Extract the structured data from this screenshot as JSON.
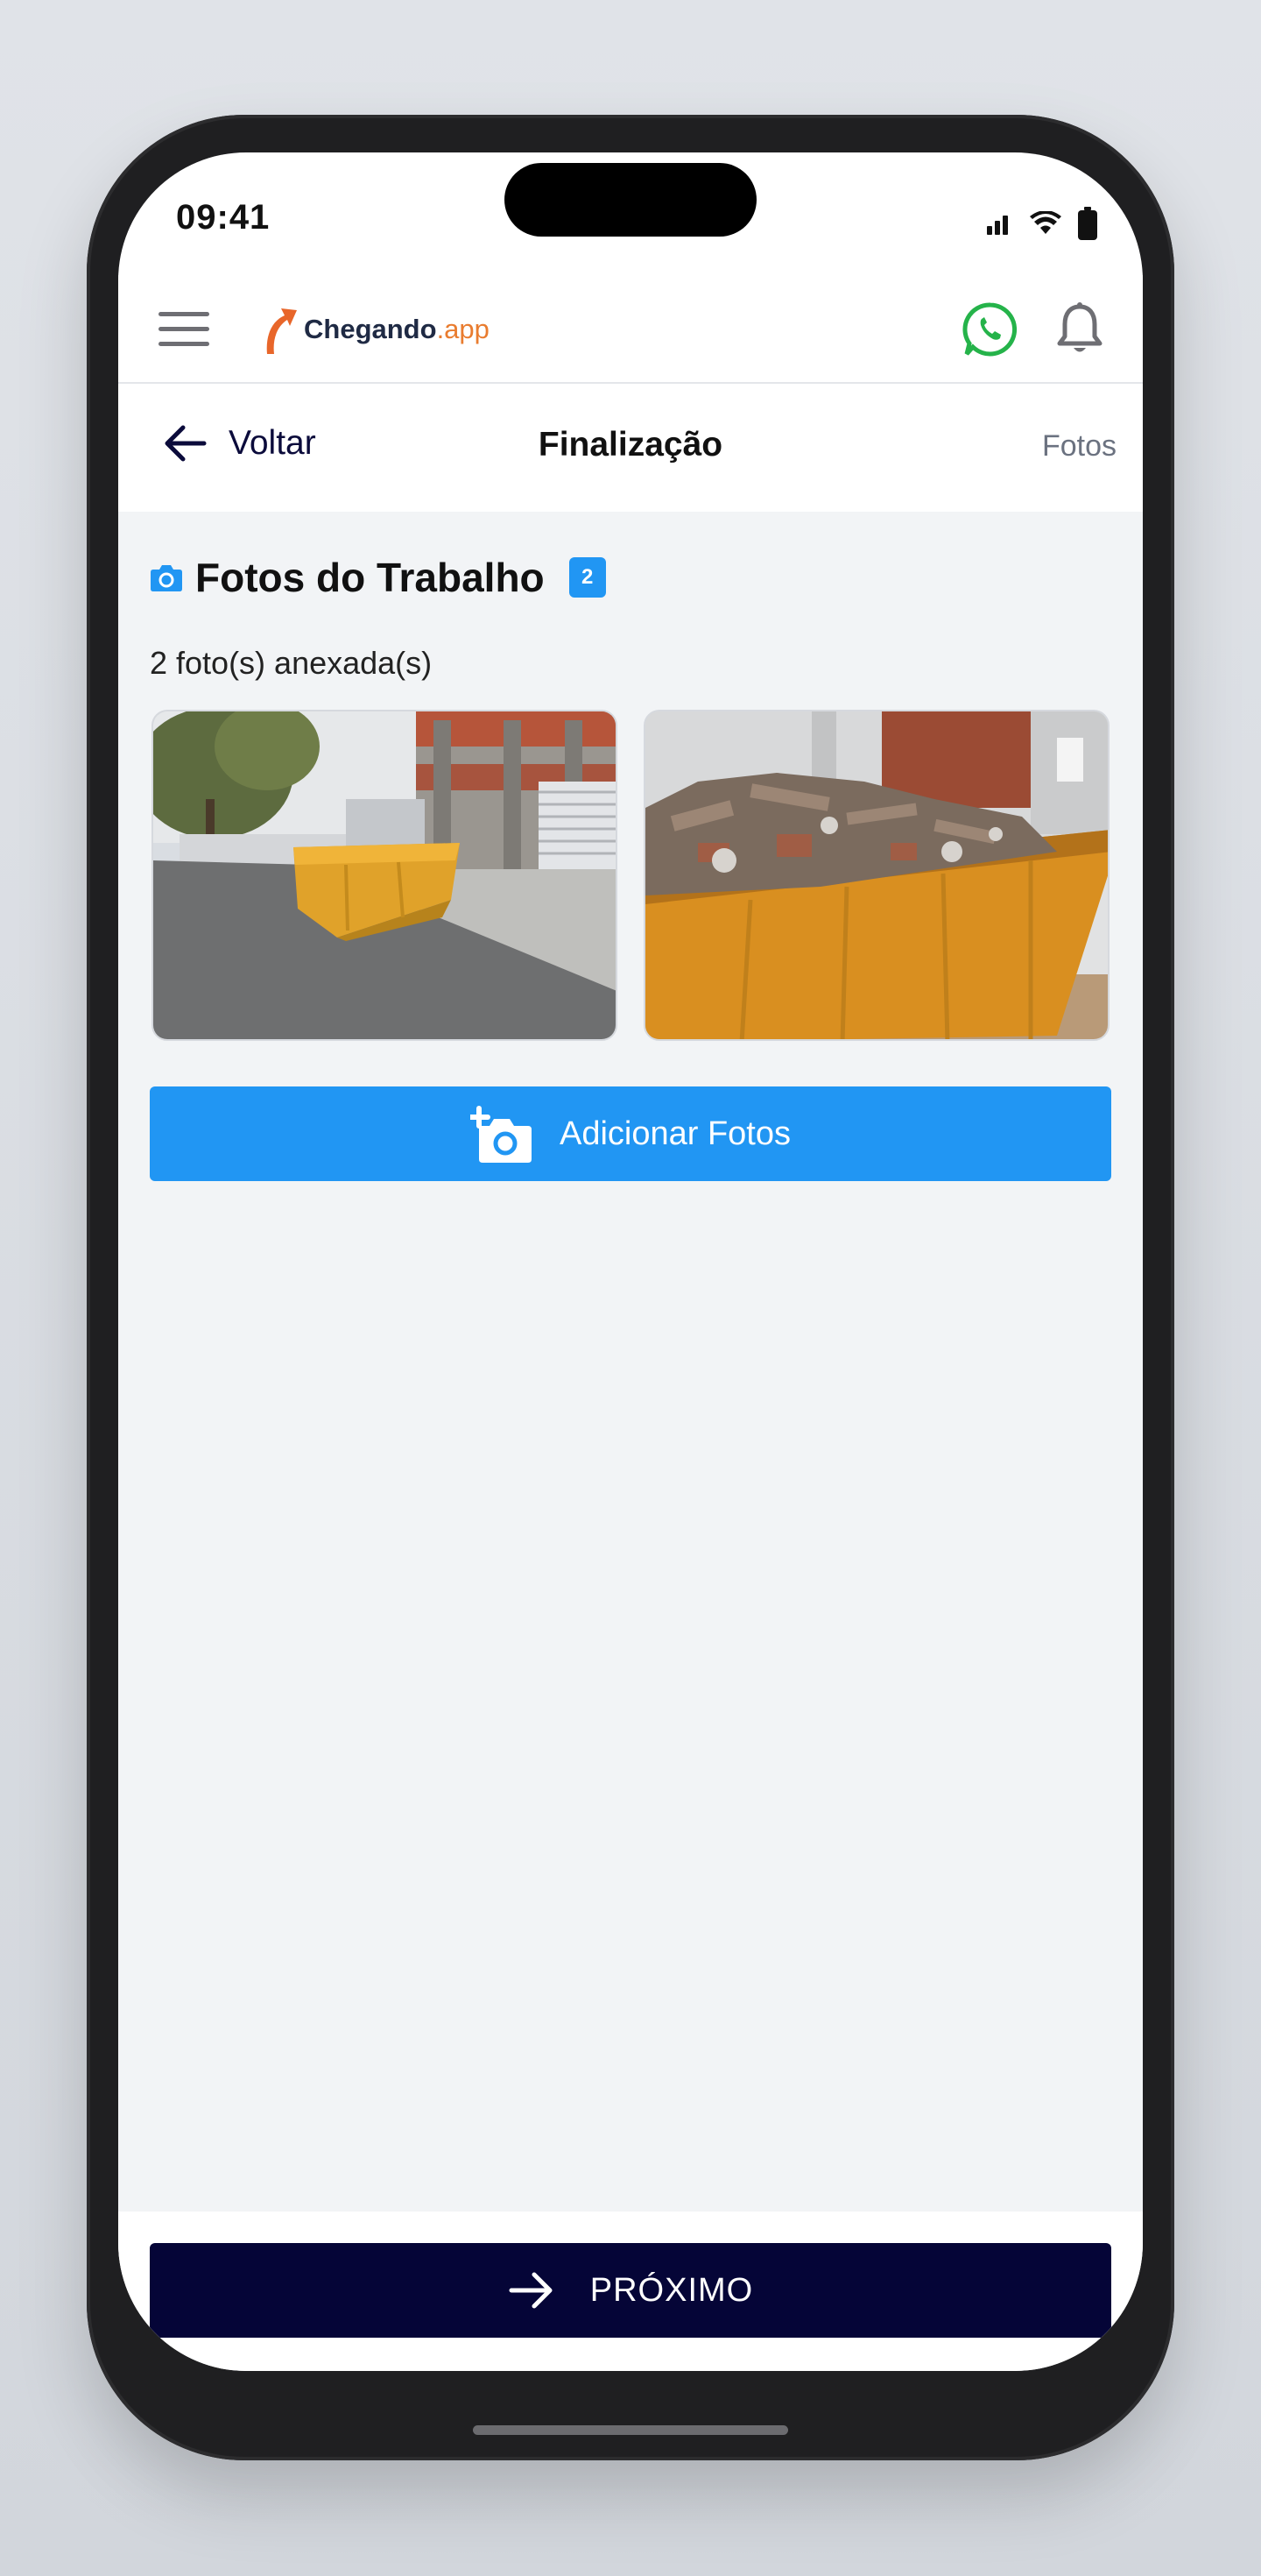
{
  "status_bar": {
    "time": "09:41",
    "signal_icon": "signal-icon",
    "wifi_icon": "wifi-icon",
    "battery_icon": "battery-icon"
  },
  "app_header": {
    "logo_text": "Chegando",
    "logo_suffix": ".app",
    "menu_icon": "hamburger-menu-icon",
    "whatsapp_icon": "whatsapp-icon",
    "notification_icon": "bell-icon"
  },
  "sub_header": {
    "back_label": "Voltar",
    "title": "Finalização",
    "right_label": "Fotos"
  },
  "section": {
    "title": "Fotos do Trabalho",
    "badge_count": "2",
    "photo_count_text": "2 foto(s) anexada(s)",
    "photos": [
      {
        "name": "dumpster-on-street-photo"
      },
      {
        "name": "dumpster-with-debris-photo"
      }
    ]
  },
  "add_button": {
    "label": "Adicionar Fotos",
    "icon": "add-photo-icon"
  },
  "next_button": {
    "label": "PRÓXIMO",
    "icon": "arrow-right-icon"
  },
  "colors": {
    "primary": "#2196f3",
    "dark_navy": "#050537",
    "accent_orange": "#e97c2f",
    "whatsapp_green": "#25b34a"
  }
}
